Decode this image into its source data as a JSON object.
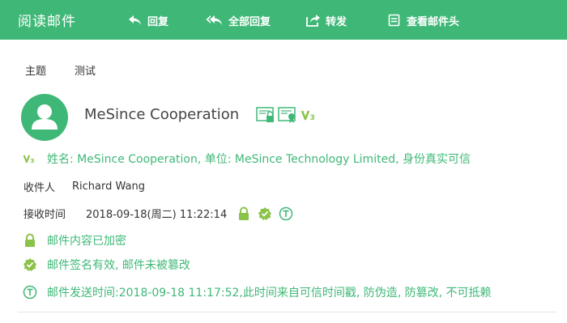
{
  "app_title": "阅读邮件",
  "toolbar": {
    "reply": "回复",
    "reply_all": "全部回复",
    "forward": "转发",
    "view_header": "查看邮件头"
  },
  "subject": {
    "label": "主题",
    "value": "测试"
  },
  "sender": {
    "name": "MeSince Cooperation",
    "identity": "姓名: MeSince Cooperation, 单位: MeSince Technology Limited, 身份真实可信"
  },
  "recipient": {
    "label": "收件人",
    "value": "Richard Wang"
  },
  "received": {
    "label": "接收时间",
    "value": "2018-09-18(周二) 11:22:14"
  },
  "security": {
    "encrypted": "邮件内容已加密",
    "signature": "邮件签名有效, 邮件未被篡改",
    "timestamp": "邮件发送时间:2018-09-18 11:17:52,此时间来自可信时间戳, 防伪造, 防篡改, 不可抵赖"
  },
  "colors": {
    "brand": "#3fb877",
    "text": "#333333"
  },
  "icons": [
    "reply-icon",
    "reply-all-icon",
    "forward-icon",
    "mail-header-icon",
    "avatar-icon",
    "certificate-lock-icon",
    "certificate-seal-icon",
    "v3-icon",
    "lock-icon",
    "verified-icon",
    "timestamp-icon"
  ]
}
